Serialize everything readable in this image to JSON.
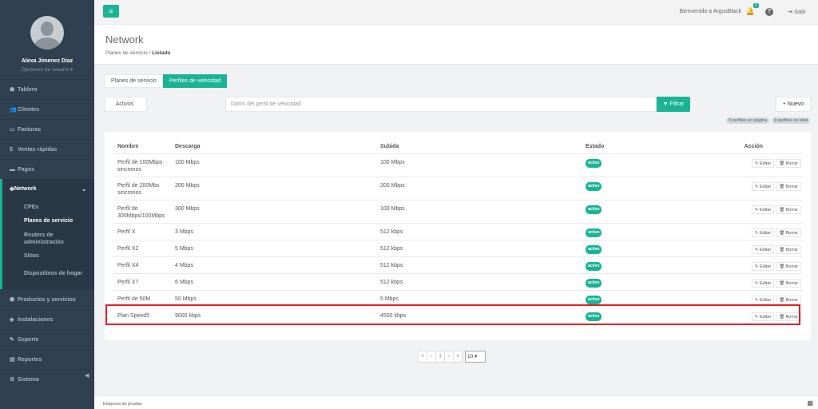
{
  "sidebar": {
    "user_name": "Alexa Jimenez Díaz",
    "user_options": "Opciones de usuario ▾",
    "items_top": [
      {
        "icon": "☗",
        "label": "Tablero"
      },
      {
        "icon": "👥",
        "label": "Clientes"
      },
      {
        "icon": "▭",
        "label": "Facturas"
      },
      {
        "icon": "$",
        "label": "Ventas rápidas"
      },
      {
        "icon": "▬",
        "label": "Pagos"
      }
    ],
    "active_section": {
      "icon": "✻",
      "label": "Network",
      "chevron": "⌄"
    },
    "sub_items": [
      "CPEs",
      "Planes de servicio",
      "Routers de administración",
      "Sitios",
      "Dispositivos de hogar"
    ],
    "items_bottom": [
      {
        "icon": "⬢",
        "label": "Productos y servicios"
      },
      {
        "icon": "◆",
        "label": "Instalaciones"
      },
      {
        "icon": "✎",
        "label": "Soporte"
      },
      {
        "icon": "▤",
        "label": "Reportes"
      },
      {
        "icon": "⚙",
        "label": "Sistema"
      }
    ],
    "collapse_icon": "◀"
  },
  "topbar": {
    "menu_icon": "≡",
    "welcome": "Bienvenido a ArgusBlack",
    "bell_icon": "🔔",
    "notifications": "1",
    "help_icon": "?",
    "logout_icon": "⇥",
    "logout": "Salir"
  },
  "header": {
    "title": "Network",
    "crumb_1": "Planes de servicio",
    "crumb_sep": "/",
    "crumb_2": "Listado"
  },
  "tabs": [
    "Planes de servicio",
    "Perfiles de velocidad"
  ],
  "filters": {
    "status_button": "Activos",
    "search_placeholder": "Datos del perfil de velocidad",
    "filter_button": "▼ Filtrar",
    "new_button": "+ Nuevo",
    "badge_page": "9 perfiles en página",
    "badge_total": "9 perfiles en total"
  },
  "table": {
    "columns": [
      "Nombre",
      "Descarga",
      "Subida",
      "Estado",
      "Acción"
    ],
    "rows": [
      {
        "nombre": "Perfil de 100Mbps sincronos",
        "descarga": "100 Mbps",
        "subida": "100 Mbps",
        "estado": "activo"
      },
      {
        "nombre": "Perfil de 200Mbs sincronos",
        "descarga": "200 Mbps",
        "subida": "200 Mbps",
        "estado": "activo"
      },
      {
        "nombre": "Perfil de 300Mbps/100Mbps",
        "descarga": "300 Mbps",
        "subida": "100 Mbps",
        "estado": "activo"
      },
      {
        "nombre": "Perfil X",
        "descarga": "3 Mbps",
        "subida": "512 kbps",
        "estado": "activo"
      },
      {
        "nombre": "Perfil X2",
        "descarga": "5 Mbps",
        "subida": "512 kbps",
        "estado": "activo"
      },
      {
        "nombre": "Perfil X4",
        "descarga": "4 Mbps",
        "subida": "512 kbps",
        "estado": "activo"
      },
      {
        "nombre": "Perfil X7",
        "descarga": "6 Mbps",
        "subida": "512 kbps",
        "estado": "activo"
      },
      {
        "nombre": "Perfil de 50M",
        "descarga": "50 Mbps",
        "subida": "5 Mbps",
        "estado": "activo"
      },
      {
        "nombre": "Plan Speed5",
        "descarga": "9000 kbps",
        "subida": "4500 kbps",
        "estado": "activo"
      }
    ],
    "edit_label": "✎ Editar",
    "delete_label": "🗑 Borrar"
  },
  "pagination": {
    "first": "«",
    "prev": "‹",
    "page": "1",
    "next": "›",
    "last": "»",
    "per_page": "10 ▾"
  },
  "footer": {
    "text": "Empresa de prueba",
    "icon": "▦"
  },
  "colors": {
    "accent": "#1ab394",
    "sidebar": "#2f4050",
    "highlight": "#e21e26"
  }
}
